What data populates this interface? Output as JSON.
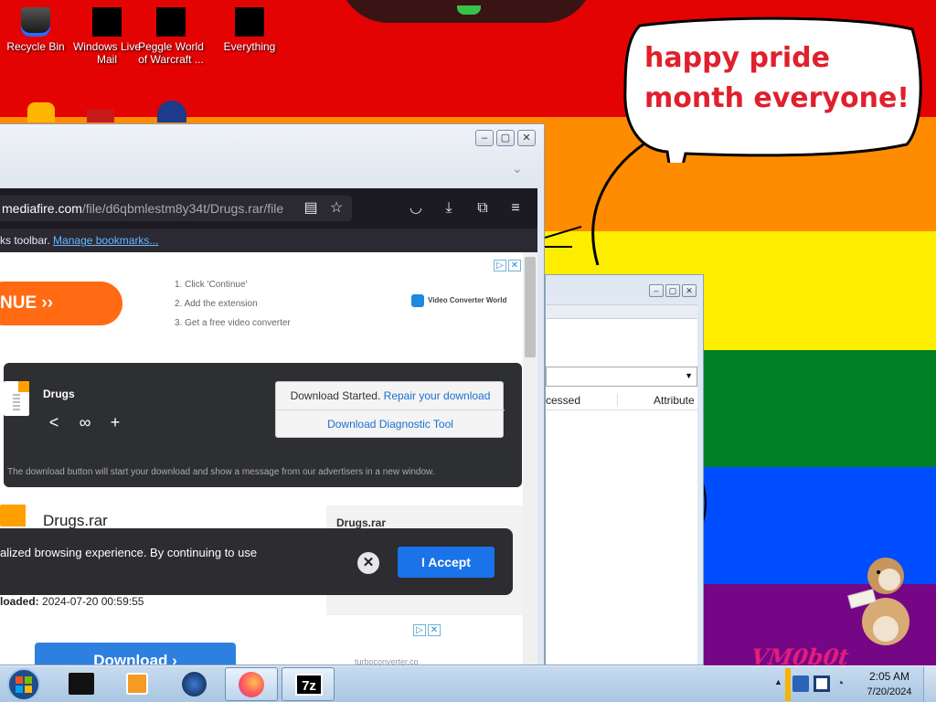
{
  "desktop": {
    "icons": [
      {
        "label": "Recycle Bin",
        "icon": "recycle-bin-icon"
      },
      {
        "label": "Windows Live Mail",
        "icon": "windows-live-mail-icon"
      },
      {
        "label": "Peggle World of Warcraft ...",
        "icon": "peggle-icon"
      },
      {
        "label": "Everything",
        "icon": "everything-search-icon"
      }
    ],
    "bubble_text": "happy pride month everyone!",
    "watermark": "VM0b0t",
    "rainbow": [
      "#e40303",
      "#ff8c00",
      "#ffed00",
      "#008026",
      "#004dff",
      "#750787"
    ]
  },
  "browser": {
    "url_host": "mediafire.com",
    "url_path": "/file/d6qbmlestm8y34t/Drugs.rar/file",
    "bookmarks_text": "ks toolbar.",
    "bookmarks_link": "Manage bookmarks...",
    "ad": {
      "cta": "NUE ››",
      "steps": [
        "1. Click 'Continue'",
        "2. Add the extension",
        "3. Get a free video converter"
      ],
      "brand": "Video Converter World"
    },
    "download_panel": {
      "file_name": "Drugs",
      "status_prefix": "Download Started.",
      "status_link": "Repair your download",
      "diagnostic": "Download Diagnostic Tool",
      "note": "The download button will start your download and show a message from our advertisers in a new window."
    },
    "file": {
      "title": "Drugs.rar",
      "side_title": "Drugs.rar",
      "uploaded_label": "loaded:",
      "uploaded_value": "2024-07-20 00:59:55",
      "download_button": "Download ›",
      "ad2_text": "turboconverter.co"
    },
    "cookie": {
      "text": "alized browsing experience. By continuing to use",
      "accept": "I Accept"
    }
  },
  "explorer_window": {
    "col_accessed": "cessed",
    "col_attributes": "Attribute"
  },
  "taskbar": {
    "time": "2:05 AM",
    "date": "7/20/2024",
    "items": [
      "app-icon",
      "media-player-icon",
      "globe-icon",
      "firefox-icon",
      "7zip-icon"
    ]
  }
}
